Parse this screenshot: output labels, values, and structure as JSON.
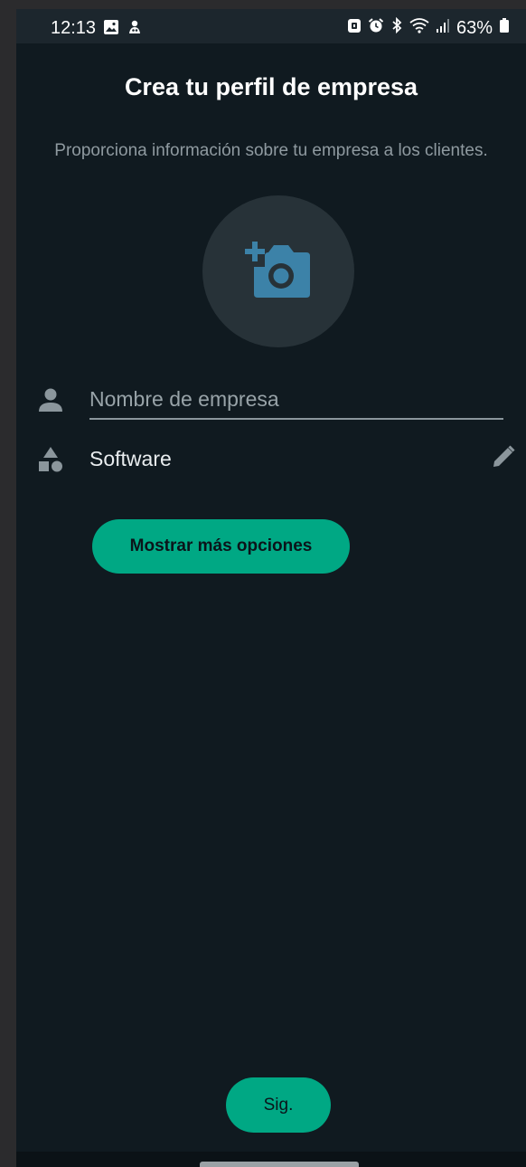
{
  "status_bar": {
    "time": "12:13",
    "battery": "63%",
    "icons": [
      "gallery-icon",
      "app-notification-icon",
      "lock-icon",
      "alarm-icon",
      "bluetooth-icon",
      "wifi-icon",
      "signal-icon",
      "battery-icon"
    ]
  },
  "header": {
    "title": "Crea tu perfil de empresa",
    "subtitle": "Proporciona información sobre tu empresa a los clientes."
  },
  "photo": {
    "icon": "add-photo-icon"
  },
  "form": {
    "name_placeholder": "Nombre de empresa",
    "name_value": "",
    "category": "Software"
  },
  "buttons": {
    "more_options": "Mostrar más opciones",
    "next": "Sig."
  },
  "colors": {
    "background": "#101a20",
    "accent": "#00a884",
    "icon_blue": "#3c82a8"
  }
}
